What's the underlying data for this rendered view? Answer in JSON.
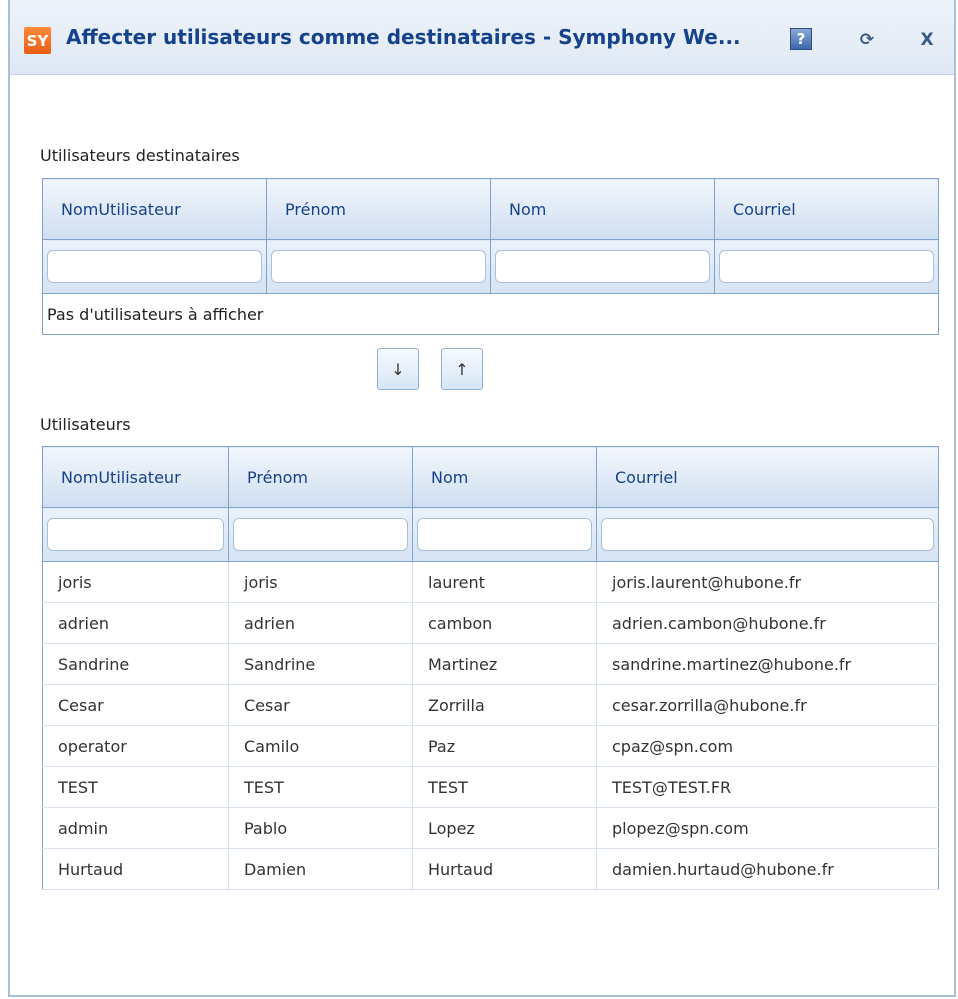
{
  "window": {
    "logo_text": "SY",
    "title": "Affecter utilisateurs comme destinataires - Symphony We...",
    "help_glyph": "?",
    "refresh_glyph": "⟳",
    "close_glyph": "X"
  },
  "recipients": {
    "label": "Utilisateurs destinataires",
    "columns": [
      "NomUtilisateur",
      "Prénom",
      "Nom",
      "Courriel"
    ],
    "empty_text": "Pas d'utilisateurs à afficher"
  },
  "move_buttons": {
    "down_glyph": "↓",
    "up_glyph": "↑"
  },
  "users": {
    "label": "Utilisateurs",
    "columns": [
      "NomUtilisateur",
      "Prénom",
      "Nom",
      "Courriel"
    ],
    "rows": [
      [
        "joris",
        "joris",
        "laurent",
        "joris.laurent@hubone.fr"
      ],
      [
        "adrien",
        "adrien",
        "cambon",
        "adrien.cambon@hubone.fr"
      ],
      [
        "Sandrine",
        "Sandrine",
        "Martinez",
        "sandrine.martinez@hubone.fr"
      ],
      [
        "Cesar",
        "Cesar",
        "Zorrilla",
        "cesar.zorrilla@hubone.fr"
      ],
      [
        "operator",
        "Camilo",
        "Paz",
        "cpaz@spn.com"
      ],
      [
        "TEST",
        "TEST",
        "TEST",
        "TEST@TEST.FR"
      ],
      [
        "admin",
        "Pablo",
        "Lopez",
        "plopez@spn.com"
      ],
      [
        "Hurtaud",
        "Damien",
        "Hurtaud",
        "damien.hurtaud@hubone.fr"
      ]
    ]
  },
  "colors": {
    "title_text": "#15428b",
    "grid_border": "#7ea3cf",
    "logo_orange": "#e85d12"
  }
}
